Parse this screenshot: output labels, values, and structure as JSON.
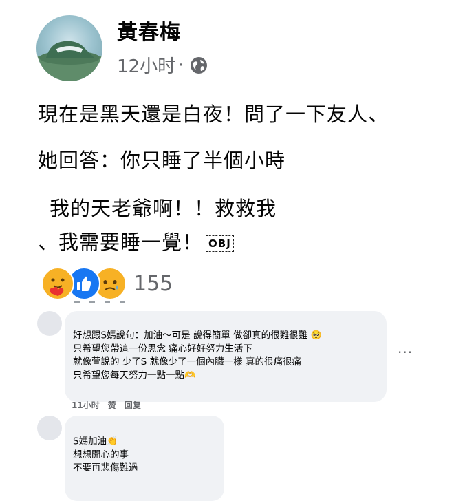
{
  "post": {
    "author": "黃春梅",
    "time": "12小时",
    "separator": "·",
    "visibility_icon": "globe-icon",
    "lines": [
      "現在是黑天還是白夜！問了一下友人、",
      "她回答：你只睡了半個小時",
      "我的天老爺啊！！救救我",
      "、我需要睡一覺！"
    ],
    "obj_placeholder": "OBJ"
  },
  "reactions": {
    "icons": [
      "care-icon",
      "like-icon",
      "sad-icon"
    ],
    "count": "155"
  },
  "comments": [
    {
      "lines": [
        "好想跟S媽說句：加油～可是 說得簡單 做卻真的很難很難",
        "只希望您帶這一份思念 痛心好好努力生活下",
        "就像萱說的 少了S 就像少了一個內臟一樣 真的很痛很痛",
        "只希望您每天努力一點一點"
      ],
      "time": "11小时",
      "like": "赞",
      "reply": "回复",
      "more": "···"
    },
    {
      "lines": [
        "S媽加油",
        "想想開心的事",
        "不要再悲傷難過"
      ]
    }
  ],
  "colors": {
    "like_blue": "#1877f2",
    "secondary_text": "#65676b",
    "bubble_bg": "#f0f2f5"
  }
}
